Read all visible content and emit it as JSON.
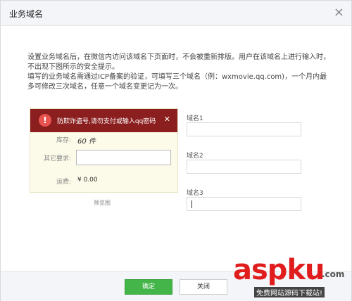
{
  "dialog": {
    "title": "业务域名",
    "close_icon": "close-icon"
  },
  "description": {
    "line1": "设置业务域名后，在微信内访问该域名下页面时，不会被重新排版。用户在该域名上进行输入时，不出现下图所示的安全提示。",
    "line2": "填写的业务域名需通过ICP备案的验证，可填写三个域名（例：wxmovie.qq.com)，一个月内最多可修改三次域名，任意一个域名变更记为一次。"
  },
  "preview": {
    "alert_icon": "exclamation-icon",
    "alert_text": "防欺诈盗号,请勿支付或输入qq密码",
    "alert_close": "✕",
    "stock_label": "库存:",
    "stock_value": "60 件",
    "other_label": "其它要求:",
    "fee_label": "运费:",
    "fee_value": "¥ 0.00",
    "caption": "预览图"
  },
  "domains": [
    {
      "label": "域名1",
      "value": ""
    },
    {
      "label": "域名2",
      "value": ""
    },
    {
      "label": "域名3",
      "value": ""
    }
  ],
  "footer": {
    "ok_label": "确定",
    "close_label": "关闭"
  },
  "watermark": {
    "brand_a": "asp",
    "brand_b": "ku",
    "domain_suffix": ".com",
    "tagline": "免费网站源码下载站!"
  },
  "colors": {
    "primary_button": "#44b549",
    "alert_bg": "#8b1e1e",
    "preview_bg": "#fcfbe9"
  }
}
